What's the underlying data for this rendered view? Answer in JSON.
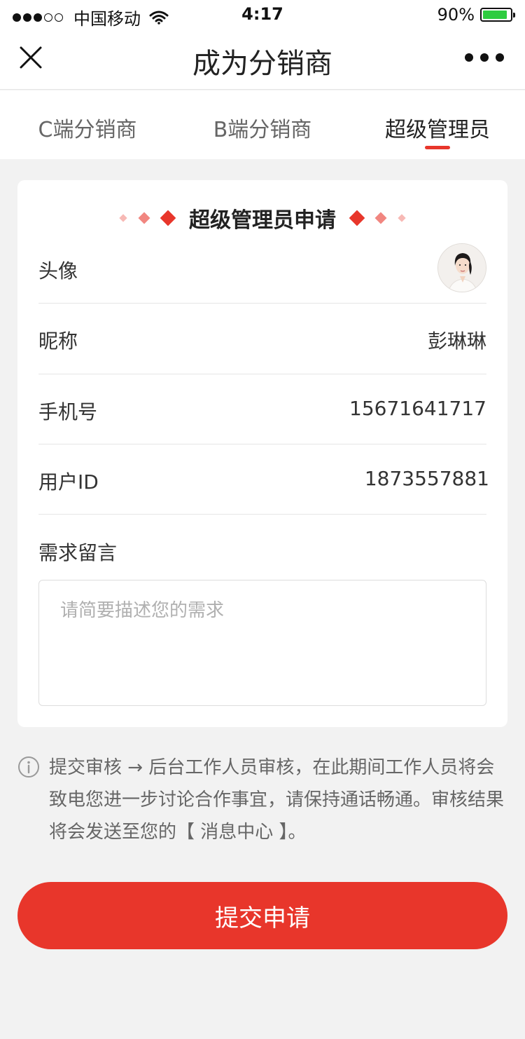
{
  "status_bar": {
    "carrier": "中国移动",
    "time": "4:17",
    "battery": "90%",
    "battery_level": 0.9
  },
  "nav": {
    "title": "成为分销商",
    "close_icon": "close-icon",
    "more_icon": "more-icon"
  },
  "tabs": [
    {
      "label": "C端分销商",
      "active": false
    },
    {
      "label": "B端分销商",
      "active": false
    },
    {
      "label": "超级管理员",
      "active": true
    }
  ],
  "card": {
    "title": "超级管理员申请",
    "avatar_label": "头像",
    "nickname_label": "昵称",
    "nickname_value": "彭琳琳",
    "phone_label": "手机号",
    "phone_value": "15671641717",
    "userid_label": "用户ID",
    "userid_value": "1873557881",
    "memo_label": "需求留言",
    "memo_placeholder": "请简要描述您的需求"
  },
  "notice": {
    "text": "提交审核 → 后台工作人员审核，在此期间工作人员将会致电您进一步讨论合作事宜，请保持通话畅通。审核结果将会发送至您的【 消息中心 】。"
  },
  "submit": {
    "label": "提交申请"
  },
  "colors": {
    "accent": "#e8362b",
    "background": "#f2f2f2"
  }
}
